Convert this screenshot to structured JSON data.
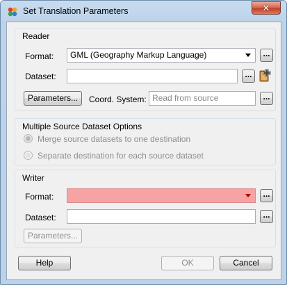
{
  "window": {
    "title": "Set Translation Parameters",
    "close_glyph": "✕"
  },
  "reader": {
    "title": "Reader",
    "format_label": "Format:",
    "format_value": "GML (Geography Markup Language)",
    "dataset_label": "Dataset:",
    "dataset_value": "",
    "parameters_button": "Parameters...",
    "coord_label": "Coord. System:",
    "coord_value": "Read from source",
    "browse_label": "..."
  },
  "multi_source": {
    "title": "Multiple Source Dataset Options",
    "option_merge": "Merge source datasets to one destination",
    "option_separate": "Separate destination for each source dataset",
    "selected": "merge"
  },
  "writer": {
    "title": "Writer",
    "format_label": "Format:",
    "format_value": "",
    "dataset_label": "Dataset:",
    "dataset_value": "",
    "parameters_button": "Parameters...",
    "browse_label": "...",
    "format_error_color": "#f7a3a3"
  },
  "footer": {
    "help": "Help",
    "ok": "OK",
    "cancel": "Cancel"
  },
  "icons": {
    "app": "fme-translation-icon",
    "add_dataset": "add-dataset-icon",
    "close": "close-icon",
    "dropdown": "chevron-down-icon"
  }
}
